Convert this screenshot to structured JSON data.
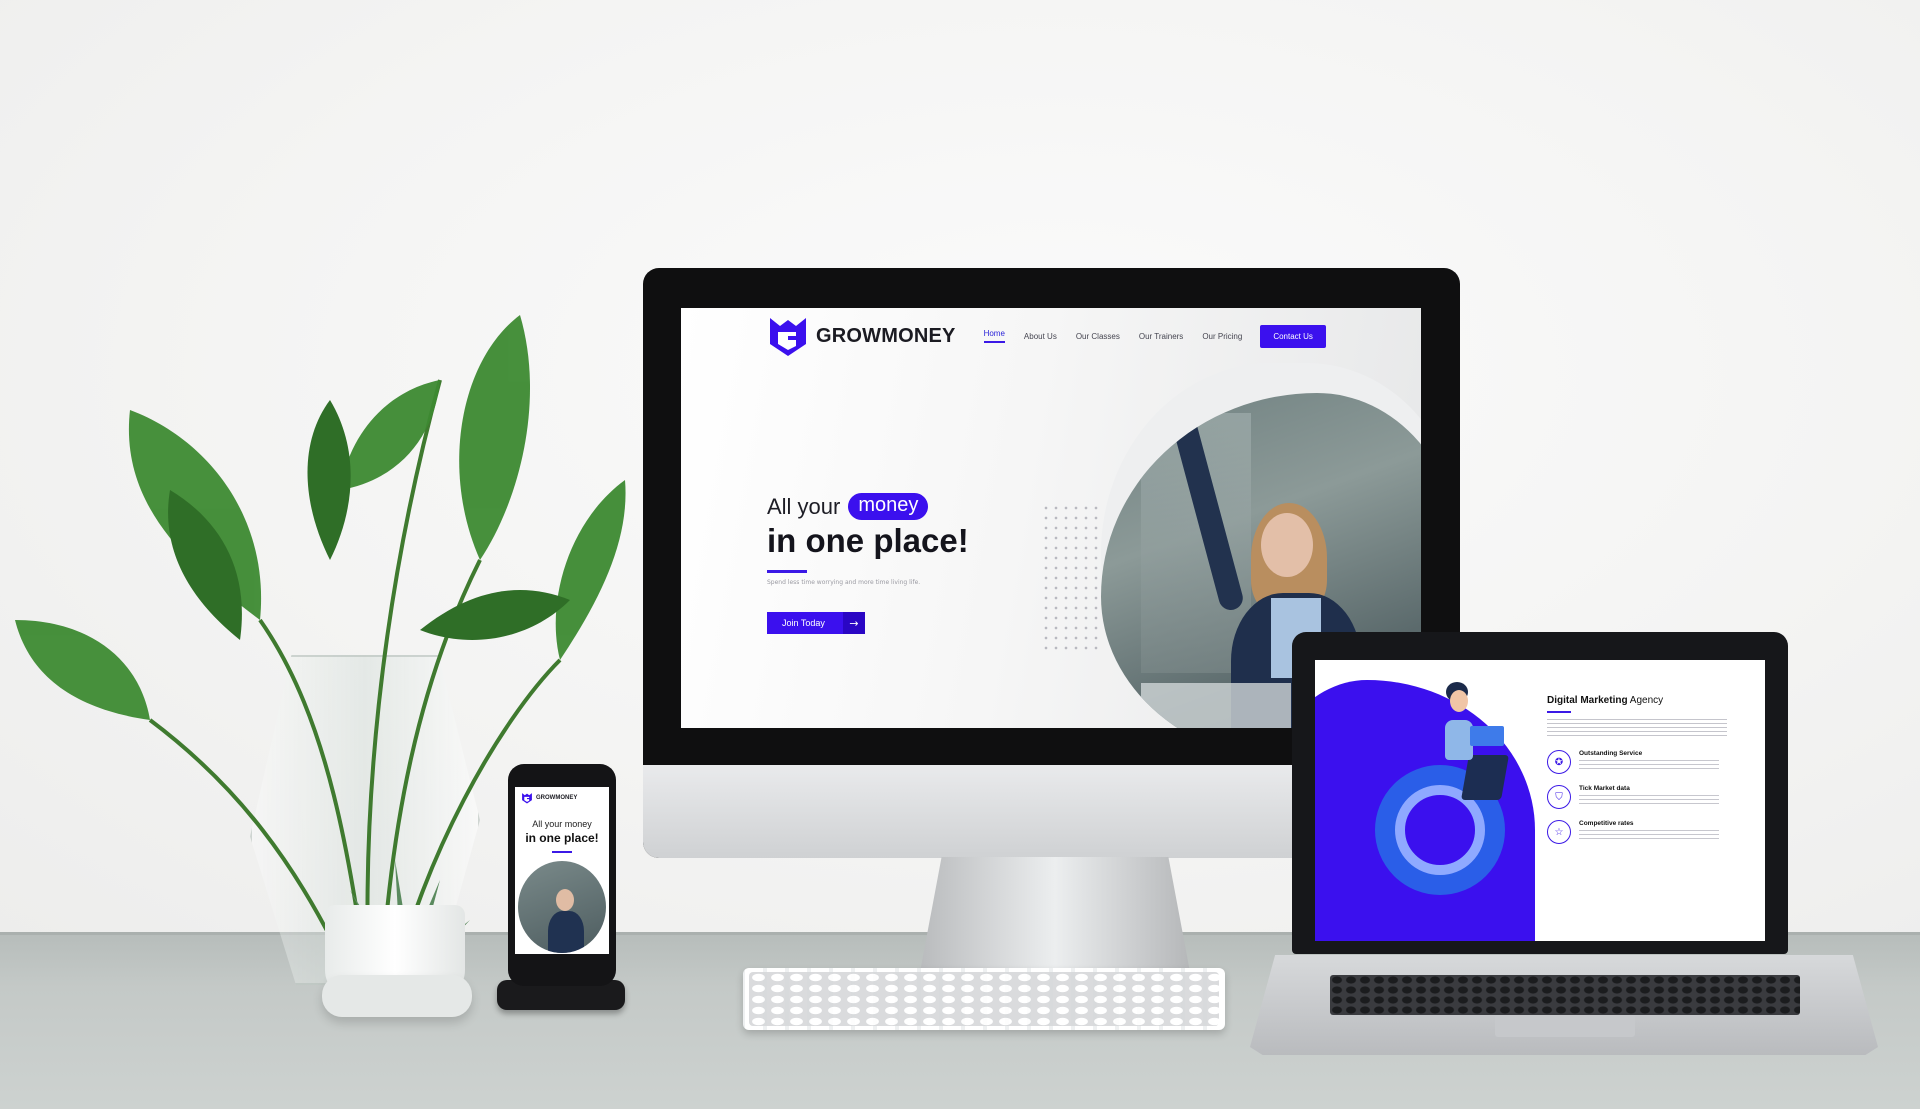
{
  "desktop": {
    "brand": "GROWMONEY",
    "nav": [
      "Home",
      "About Us",
      "Our Classes",
      "Our Trainers",
      "Our Pricing"
    ],
    "contact_button": "Contact Us",
    "hero": {
      "line1_prefix": "All your",
      "line1_highlight": "money",
      "line2": "in one place!",
      "subtitle": "Spend less time worrying and more time living life.",
      "cta": "Join Today",
      "cta_icon": "arrow-right-icon"
    }
  },
  "phone": {
    "brand": "GROWMONEY",
    "line1": "All your money",
    "line2": "in one place!"
  },
  "laptop": {
    "title_bold": "Digital Marketing",
    "title_rest": " Agency",
    "features": [
      {
        "name": "Outstanding Service",
        "icon": "medal-icon"
      },
      {
        "name": "Tick Market data",
        "icon": "shield-icon"
      },
      {
        "name": "Competitive rates",
        "icon": "star-icon"
      }
    ]
  },
  "colors": {
    "brand_primary": "#3b10ee",
    "brand_dark": "#2a06c4",
    "text_dark": "#14141c"
  }
}
